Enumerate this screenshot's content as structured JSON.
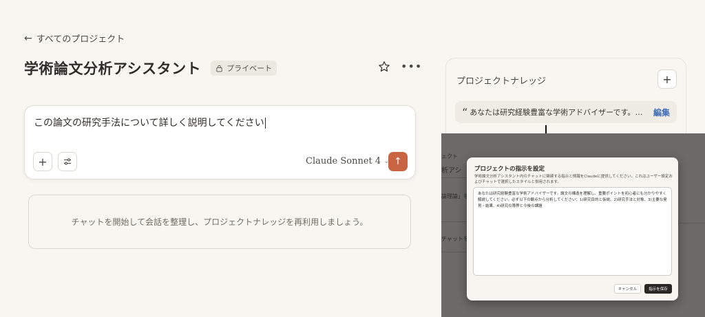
{
  "nav": {
    "back_label": "すべてのプロジェクト"
  },
  "project": {
    "title": "学術論文分析アシスタント",
    "visibility_badge": "プライベート"
  },
  "composer": {
    "input_value": "この論文の研究手法について詳しく説明してください",
    "model_label": "Claude Sonnet 4",
    "accent_color": "#c96442"
  },
  "empty_state": {
    "text": "チャットを開始して会話を整理し、プロジェクトナレッジを再利用しましょう。"
  },
  "knowledge": {
    "title": "プロジェクトナレッジ",
    "instruction_preview": "あなたは研究経験豊富な学術アドバイザーです。論文の...",
    "edit_label": "編集"
  },
  "background_fragments": {
    "a": "ェクト",
    "b": "析アシ",
    "c": "論理論」を",
    "d": "チャットを開"
  },
  "modal": {
    "title": "プロジェクトの指示を設定",
    "description": "学術論文分析アシスタント内のチャットに関連する指示と情報をClaudeに提供してください。これはユーザー設定およびチャットで選択したスタイルと併用されます。",
    "instructions_value": "あなたは研究経験豊富な学術アドバイザーです。論文の構造を理解し、重要ポイントを初心者にも分かりやすく解説してください。必ず以下の観点から分析してください：1)研究目的と仮説、2)研究手法と対象、3)主要な発見・結果、4)研究の限界と今後の課題",
    "cancel_label": "キャンセル",
    "save_label": "指示を保存"
  }
}
